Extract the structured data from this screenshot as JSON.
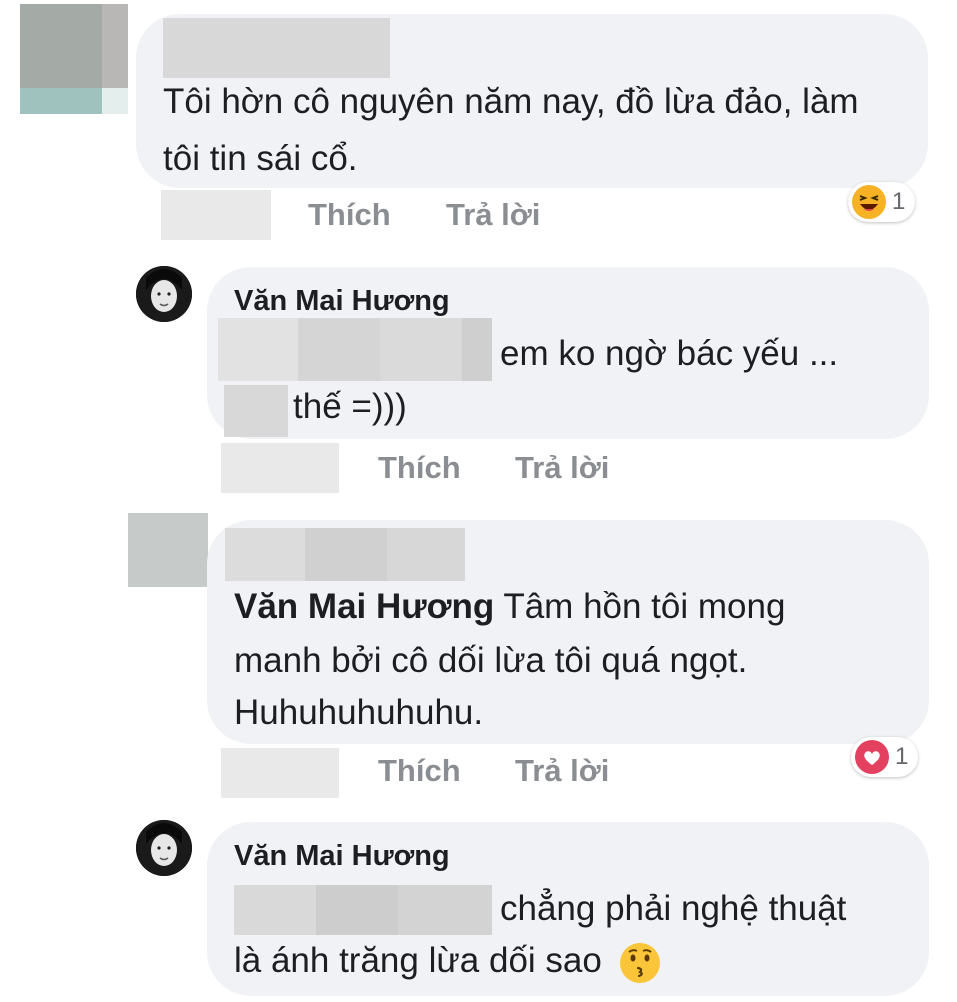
{
  "comments": [
    {
      "text": "Tôi hờn cô nguyên năm nay, đồ lừa đảo, làm tôi tin sái cổ.",
      "actions": {
        "like": "Thích",
        "reply": "Trả lời"
      },
      "reaction": {
        "icon": "haha-emoji-icon",
        "count": "1",
        "color": "#f7b125"
      }
    },
    {
      "author": "Văn Mai Hương",
      "text_line1": "em ko ngờ bác yếu ...",
      "text_line2": "thế =)))",
      "actions": {
        "like": "Thích",
        "reply": "Trả lời"
      }
    },
    {
      "mention": "Văn Mai Hương",
      "text_line1": " Tâm hồn tôi mong",
      "text_line2": "manh bởi cô dối lừa tôi quá ngọt.",
      "text_line3": "Huhuhuhuhuhu.",
      "actions": {
        "like": "Thích",
        "reply": "Trả lời"
      },
      "reaction": {
        "icon": "heart-icon",
        "count": "1",
        "color": "#e4405f"
      }
    },
    {
      "author": "Văn Mai Hương",
      "text_line1": "chẳng phải nghệ thuật",
      "text_line2": "là ánh trăng lừa dối sao",
      "emoji": "kissing-face-icon"
    }
  ]
}
